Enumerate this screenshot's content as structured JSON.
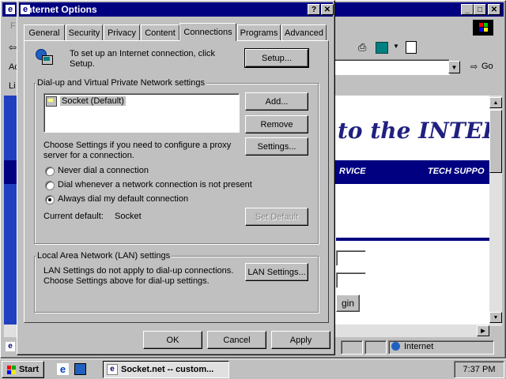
{
  "browser": {
    "title_icon": "ie-icon",
    "menu_letter_f": "F",
    "address_label": "Ad",
    "links_label": "Li",
    "go_label": "Go",
    "status_zone": "Internet",
    "hero_text": "to the INTER",
    "nav_items": [
      "RVICE",
      "TECH SUPPO"
    ],
    "login_button": "gin"
  },
  "dialog": {
    "title": "Internet Options",
    "help_btn": "?",
    "close_btn": "✕",
    "tabs": [
      "General",
      "Security",
      "Privacy",
      "Content",
      "Connections",
      "Programs",
      "Advanced"
    ],
    "active_tab": "Connections",
    "setup_text": "To set up an Internet connection, click Setup.",
    "setup_button": "Setup...",
    "dialup_group": "Dial-up and Virtual Private Network settings",
    "connections": [
      "Socket (Default)"
    ],
    "add_button": "Add...",
    "remove_button": "Remove",
    "settings_text": "Choose Settings if you need to configure a proxy server for a connection.",
    "settings_button": "Settings...",
    "radio_options": [
      {
        "label": "Never dial a connection",
        "checked": false
      },
      {
        "label": "Dial whenever a network connection is not present",
        "checked": false
      },
      {
        "label": "Always dial my default connection",
        "checked": true
      }
    ],
    "current_default_label": "Current default:",
    "current_default_value": "Socket",
    "set_default_button": "Set Default",
    "lan_group": "Local Area Network (LAN) settings",
    "lan_text": "LAN Settings do not apply to dial-up connections. Choose Settings above for dial-up settings.",
    "lan_button": "LAN Settings...",
    "ok_button": "OK",
    "cancel_button": "Cancel",
    "apply_button": "Apply"
  },
  "taskbar": {
    "start_label": "Start",
    "task_label": "Socket.net -- custom...",
    "clock": "7:37 PM"
  }
}
